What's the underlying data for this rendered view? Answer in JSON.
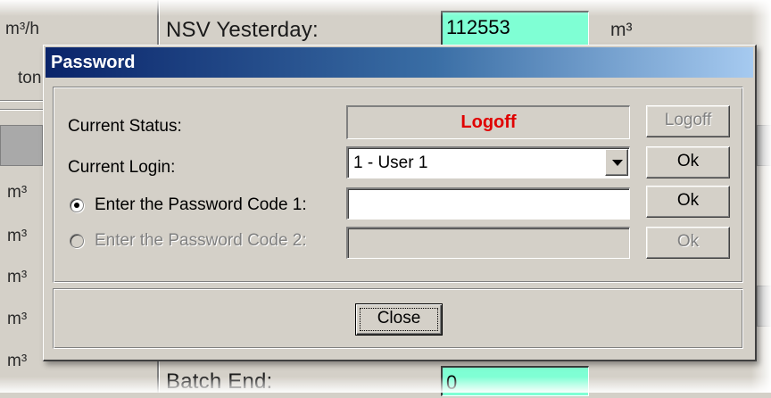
{
  "background": {
    "units_left": [
      "m³/h",
      "ton",
      "m³",
      "m³",
      "m³",
      "m³",
      "m³"
    ],
    "nsv_label": "NSV Yesterday:",
    "nsv_value": "112553",
    "nsv_unit": "m³",
    "batch_label": "Batch End:",
    "batch_value": "0"
  },
  "dialog": {
    "title": "Password",
    "current_status_label": "Current Status:",
    "current_status_value": "Logoff",
    "current_login_label": "Current Login:",
    "current_login_value": "1 - User 1",
    "password1_label": "Enter the Password Code 1:",
    "password1_value": "",
    "password2_label": "Enter the Password Code 2:",
    "password2_value": "",
    "logoff_button": "Logoff",
    "ok_button_login": "Ok",
    "ok_button_pwd1": "Ok",
    "ok_button_pwd2": "Ok",
    "close_button": "Close",
    "selected_radio": "password-code-1"
  },
  "colors": {
    "titlebar_start": "#0a246a",
    "titlebar_end": "#a6caf0",
    "status_text": "#e00000",
    "field_highlight": "#7fffd4"
  }
}
